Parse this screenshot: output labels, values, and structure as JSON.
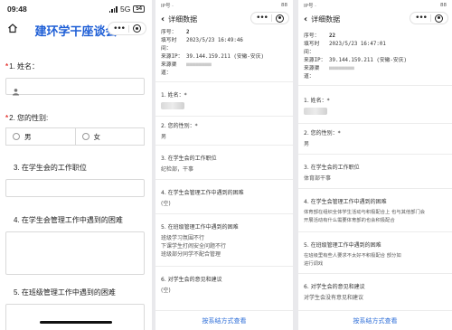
{
  "form": {
    "status_time": "09:48",
    "network": "5G",
    "battery": "54",
    "title": "建环学干座谈会",
    "questions": [
      {
        "num": "1.",
        "label": "姓名：",
        "required": true,
        "placeholder_icon": "person-icon"
      },
      {
        "num": "2.",
        "label": "您的性别:",
        "required": true,
        "options": [
          "男",
          "女"
        ]
      },
      {
        "num": "3.",
        "label": "在学生会的工作职位",
        "required": false
      },
      {
        "num": "4.",
        "label": "在学生会管理工作中遇到的困难",
        "required": false
      },
      {
        "num": "5.",
        "label": "在班级管理工作中遇到的困难",
        "required": false
      }
    ]
  },
  "detail_a": {
    "status_left": "IP号 ·",
    "status_right": "88",
    "nav_title": "详细数据",
    "meta": [
      {
        "k": "序号：",
        "v": "2"
      },
      {
        "k": "填写时间：",
        "v": "2023/5/23 16:49:46"
      },
      {
        "k": "来源IP：",
        "v": "39.144.159.211 (安徽-安庆)"
      },
      {
        "k": "来源渠道：",
        "v": "■■■■■■■■"
      }
    ],
    "sections": [
      {
        "q": "1. 姓名：*",
        "a": []
      },
      {
        "q": "2. 您的性别：*",
        "a": [
          "男"
        ]
      },
      {
        "q": "3. 在学生会的工作职位",
        "a": [
          "纪检部，干事"
        ]
      },
      {
        "q": "4. 在学生会管理工作中遇到的困难",
        "a": [
          "(空)"
        ]
      },
      {
        "q": "5. 在班级管理工作中遇到的困难",
        "a": [
          "班级学习氛围不行",
          "下课学生打闹安全问题不行",
          "班级部分同学不配合管理"
        ]
      },
      {
        "q": "6. 对学生会的意见和建议",
        "a": [
          "(空)"
        ]
      }
    ],
    "footer": "按系结方式查看"
  },
  "detail_b": {
    "status_left": "IP号 ·",
    "status_right": "88",
    "nav_title": "详细数据",
    "meta": [
      {
        "k": "序号：",
        "v": "22"
      },
      {
        "k": "填写时间：",
        "v": "2023/5/23 16:47:01"
      },
      {
        "k": "来源IP：",
        "v": "39.144.159.211 (安徽-安庆)"
      },
      {
        "k": "来源渠道：",
        "v": "■■■■■■■■"
      }
    ],
    "sections": [
      {
        "q": "1. 姓名：*",
        "a": []
      },
      {
        "q": "2. 您的性别：*",
        "a": [
          "男"
        ]
      },
      {
        "q": "3. 在学生会的工作职位",
        "a": [
          "体育部干事"
        ]
      },
      {
        "q": "4. 在学生会管理工作中遇到的困难",
        "a": [
          "体育部在组织全体学生活动与积极配合上 也与其他部门会",
          "开展活动有什么需要体育部的也会积极配合"
        ]
      },
      {
        "q": "5. 在班级管理工作中遇到的困难",
        "a": [
          "在班级里有些人要求不太好不积极配合 部分如",
          "进行调戏"
        ]
      },
      {
        "q": "6. 对学生会的意见和建议",
        "a": [
          "对学生会没有意见和建议"
        ]
      }
    ],
    "footer": "按系结方式查看"
  }
}
